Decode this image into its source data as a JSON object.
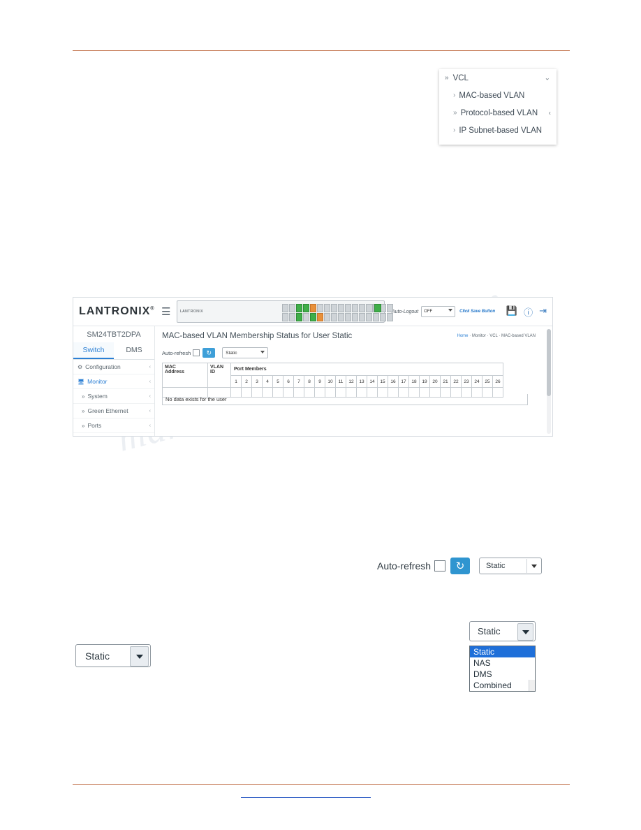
{
  "watermark": {
    "line1": "manualshive",
    "line2": ".com"
  },
  "vcl_menu": {
    "header": {
      "label": "VCL",
      "chevron": "»",
      "caret": "⌄"
    },
    "items": [
      {
        "label": "MAC-based VLAN",
        "chevron": "›",
        "caret": ""
      },
      {
        "label": "Protocol-based VLAN",
        "chevron": "»",
        "caret": "‹"
      },
      {
        "label": "IP Subnet-based VLAN",
        "chevron": "›",
        "caret": ""
      }
    ]
  },
  "webui": {
    "brand": "LANTRONIX",
    "brand_sup": "®",
    "hamburger_icon": "☰",
    "switch_label": "LANTRONIX",
    "auto_logout_label": "Auto-Logout",
    "auto_logout_value": "OFF",
    "click_restart": "Click Save Button",
    "top_icons": [
      "save-icon",
      "help-icon",
      "logout-icon"
    ],
    "model": "SM24TBT2DPA",
    "tabs": [
      {
        "label": "Switch",
        "active": true
      },
      {
        "label": "DMS",
        "active": false
      }
    ],
    "sidebar": [
      {
        "label": "Configuration",
        "icon": "gear-icon",
        "caret": "‹",
        "selected": false
      },
      {
        "label": "Monitor",
        "icon": "monitor-icon",
        "caret": "‹",
        "selected": true
      },
      {
        "label": "System",
        "icon": "»",
        "caret": "‹",
        "selected": false
      },
      {
        "label": "Green Ethernet",
        "icon": "»",
        "caret": "‹",
        "selected": false
      },
      {
        "label": "Ports",
        "icon": "»",
        "caret": "‹",
        "selected": false
      }
    ],
    "page_title": "MAC-based VLAN Membership Status for User Static",
    "breadcrumb": {
      "home": "Home",
      "path": "·  Monitor  ·   VCL  ·   MAC-based VLAN"
    },
    "auto_refresh_label": "Auto-refresh",
    "refresh_icon": "refresh-icon",
    "user_select_value": "Static",
    "table": {
      "col_mac": "MAC Address",
      "col_vlan": "VLAN ID",
      "col_portmembers": "Port Members",
      "ports": [
        "1",
        "2",
        "3",
        "4",
        "5",
        "6",
        "7",
        "8",
        "9",
        "10",
        "11",
        "12",
        "13",
        "14",
        "15",
        "16",
        "17",
        "18",
        "19",
        "20",
        "21",
        "22",
        "23",
        "24",
        "25",
        "26"
      ],
      "empty_message": "No data exists for the user"
    }
  },
  "mid_controls": {
    "auto_refresh_label": "Auto-refresh",
    "refresh_icon": "refresh-icon",
    "select_value": "Static"
  },
  "left_select": {
    "value": "Static"
  },
  "dropdown": {
    "value": "Static",
    "options": [
      "Static",
      "NAS",
      "DMS",
      "Combined"
    ],
    "selected_index": 0
  }
}
